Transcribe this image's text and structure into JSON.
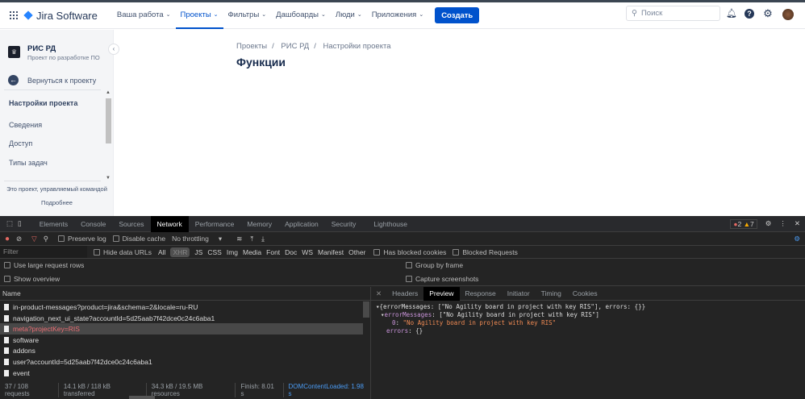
{
  "nav": {
    "product": "Jira Software",
    "menu": [
      {
        "label": "Ваша работа"
      },
      {
        "label": "Проекты",
        "active": true
      },
      {
        "label": "Фильтры"
      },
      {
        "label": "Дашбоарды"
      },
      {
        "label": "Люди"
      },
      {
        "label": "Приложения"
      }
    ],
    "create": "Создать",
    "search_placeholder": "Поиск"
  },
  "sidebar": {
    "project_name": "РИС РД",
    "project_sub": "Проект по разработке ПО",
    "back": "Вернуться к проекту",
    "section": "Настройки проекта",
    "items": [
      "Сведения",
      "Доступ",
      "Типы задач"
    ],
    "footer": "Это проект, управляемый командой",
    "more": "Подробнее"
  },
  "main": {
    "breadcrumbs": [
      "Проекты",
      "РИС РД",
      "Настройки проекта"
    ],
    "title": "Функции"
  },
  "devtools": {
    "tabs": [
      "Elements",
      "Console",
      "Sources",
      "Network",
      "Performance",
      "Memory",
      "Application",
      "Security",
      "Lighthouse"
    ],
    "errors": "2",
    "warnings": "7",
    "toolbar": {
      "preserve_log": "Preserve log",
      "disable_cache": "Disable cache",
      "throttling": "No throttling"
    },
    "filter": {
      "placeholder": "Filter",
      "hide_data_urls": "Hide data URLs",
      "types": [
        "All",
        "XHR",
        "JS",
        "CSS",
        "Img",
        "Media",
        "Font",
        "Doc",
        "WS",
        "Manifest",
        "Other"
      ],
      "has_blocked": "Has blocked cookies",
      "blocked_requests": "Blocked Requests"
    },
    "options": {
      "large_rows": "Use large request rows",
      "group_by_frame": "Group by frame",
      "show_overview": "Show overview",
      "capture": "Capture screenshots"
    },
    "name_header": "Name",
    "requests": [
      "in-product-messages?product=jira&schema=2&locale=ru-RU",
      "navigation_next_ui_state?accountId=5d25aab7f42dce0c24c6aba1",
      "meta?projectKey=RIS",
      "software",
      "addons",
      "user?accountId=5d25aab7f42dce0c24c6aba1",
      "event"
    ],
    "panel_tabs": [
      "Headers",
      "Preview",
      "Response",
      "Initiator",
      "Timing",
      "Cookies"
    ],
    "preview": {
      "line1": "{errorMessages: [\"No Agility board in project with key RIS\"], errors: {}}",
      "key1": "errorMessages",
      "val1": ": [\"No Agility board in project with key RIS\"]",
      "idx": "0",
      "val2": "\"No Agility board in project with key RIS\"",
      "key2": "errors",
      "val3": ": {}"
    },
    "status": [
      "37 / 108 requests",
      "14.1 kB / 118 kB transferred",
      "34.3 kB / 19.5 MB resources",
      "Finish: 8.01 s",
      "DOMContentLoaded: 1.98 s"
    ]
  }
}
